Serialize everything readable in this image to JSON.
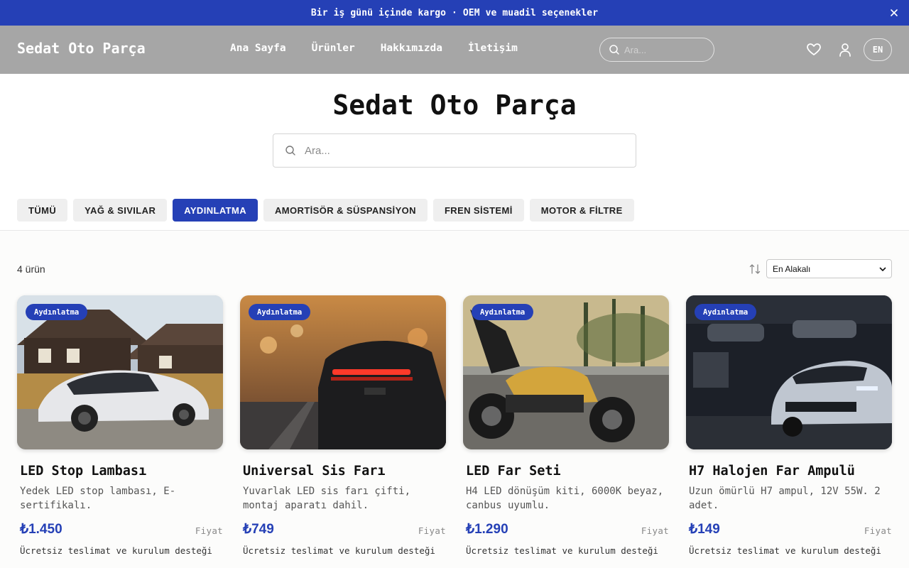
{
  "announcement": {
    "text": "Bir iş günü içinde kargo · OEM ve muadil seçenekler"
  },
  "header": {
    "brand": "Sedat Oto Parça",
    "nav": [
      "Ana Sayfa",
      "Ürünler",
      "Hakkımızda",
      "İletişim"
    ],
    "search_placeholder": "Ara...",
    "lang": "EN"
  },
  "hero": {
    "title": "Sedat Oto Parça",
    "search_placeholder": "Ara..."
  },
  "categories": {
    "items": [
      "TÜMÜ",
      "YAĞ & SIVILAR",
      "AYDINLATMA",
      "AMORTİSÖR & SÜSPANSİYON",
      "FREN SİSTEMİ",
      "MOTOR & FİLTRE"
    ],
    "active": "AYDINLATMA"
  },
  "listing": {
    "count": "4 ürün",
    "sort_selected": "En Alakalı"
  },
  "products": [
    {
      "badge": "Aydınlatma",
      "name": "LED Stop Lambası",
      "desc": "Yedek LED stop lambası, E-sertifikalı.",
      "price": "₺1.450",
      "price_label": "Fiyat",
      "shipping": "Ücretsiz teslimat ve kurulum desteği"
    },
    {
      "badge": "Aydınlatma",
      "name": "Universal Sis Farı",
      "desc": "Yuvarlak LED sis farı çifti, montaj aparatı dahil.",
      "price": "₺749",
      "price_label": "Fiyat",
      "shipping": "Ücretsiz teslimat ve kurulum desteği"
    },
    {
      "badge": "Aydınlatma",
      "name": "LED Far Seti",
      "desc": "H4 LED dönüşüm kiti, 6000K beyaz, canbus uyumlu.",
      "price": "₺1.290",
      "price_label": "Fiyat",
      "shipping": "Ücretsiz teslimat ve kurulum desteği"
    },
    {
      "badge": "Aydınlatma",
      "name": "H7 Halojen Far Ampulü",
      "desc": "Uzun ömürlü H7 ampul, 12V 55W. 2 adet.",
      "price": "₺149",
      "price_label": "Fiyat",
      "shipping": "Ücretsiz teslimat ve kurulum desteği"
    }
  ],
  "colors": {
    "accent": "#2540b6",
    "header_bg": "#a6a6a6",
    "chip_bg": "#efefef"
  },
  "icons": [
    "close-icon",
    "search-icon",
    "heart-icon",
    "user-icon",
    "sort-icon",
    "chevron-down-icon"
  ]
}
